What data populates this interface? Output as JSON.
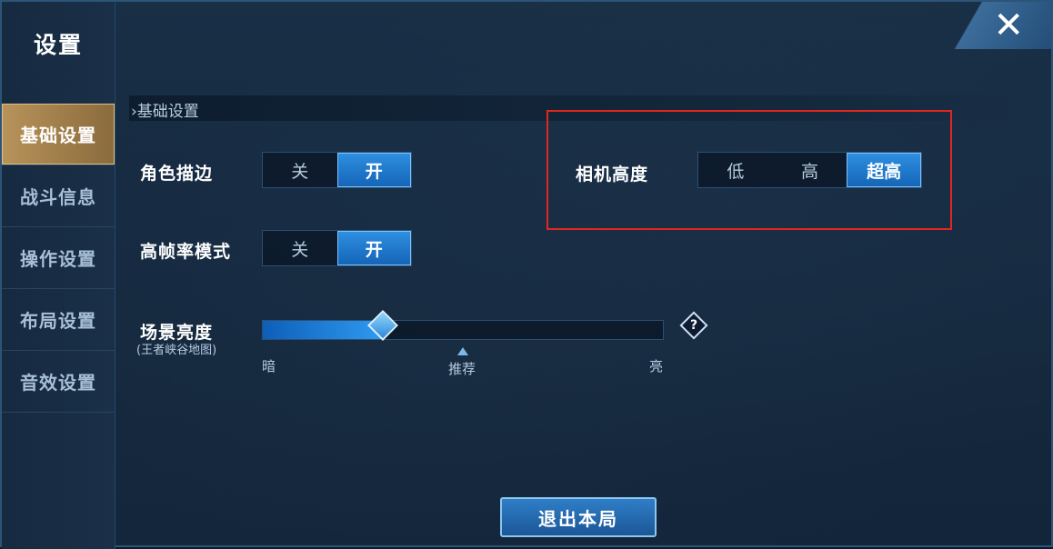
{
  "window": {
    "title": "设置",
    "close_label": "✕"
  },
  "sidebar": {
    "items": [
      {
        "label": "基础设置",
        "active": true
      },
      {
        "label": "战斗信息",
        "active": false
      },
      {
        "label": "操作设置",
        "active": false
      },
      {
        "label": "布局设置",
        "active": false
      },
      {
        "label": "音效设置",
        "active": false
      }
    ]
  },
  "main": {
    "section_title": "›基础设置",
    "outline": {
      "label": "角色描边",
      "options": [
        "关",
        "开"
      ],
      "selected": "开"
    },
    "high_fps": {
      "label": "高帧率模式",
      "options": [
        "关",
        "开"
      ],
      "selected": "开"
    },
    "camera_height": {
      "label": "相机高度",
      "options": [
        "低",
        "高",
        "超高"
      ],
      "selected": "超高"
    },
    "brightness": {
      "label": "场景亮度",
      "sublabel": "(王者峡谷地图)",
      "value_fraction": 0.3,
      "min_label": "暗",
      "recommended_label": "推荐",
      "max_label": "亮",
      "help_label": "?"
    }
  },
  "footer": {
    "exit_label": "退出本局"
  },
  "colors": {
    "accent": "#1e78d2",
    "active_tab": "#a9854f",
    "highlight": "#e2261d"
  }
}
